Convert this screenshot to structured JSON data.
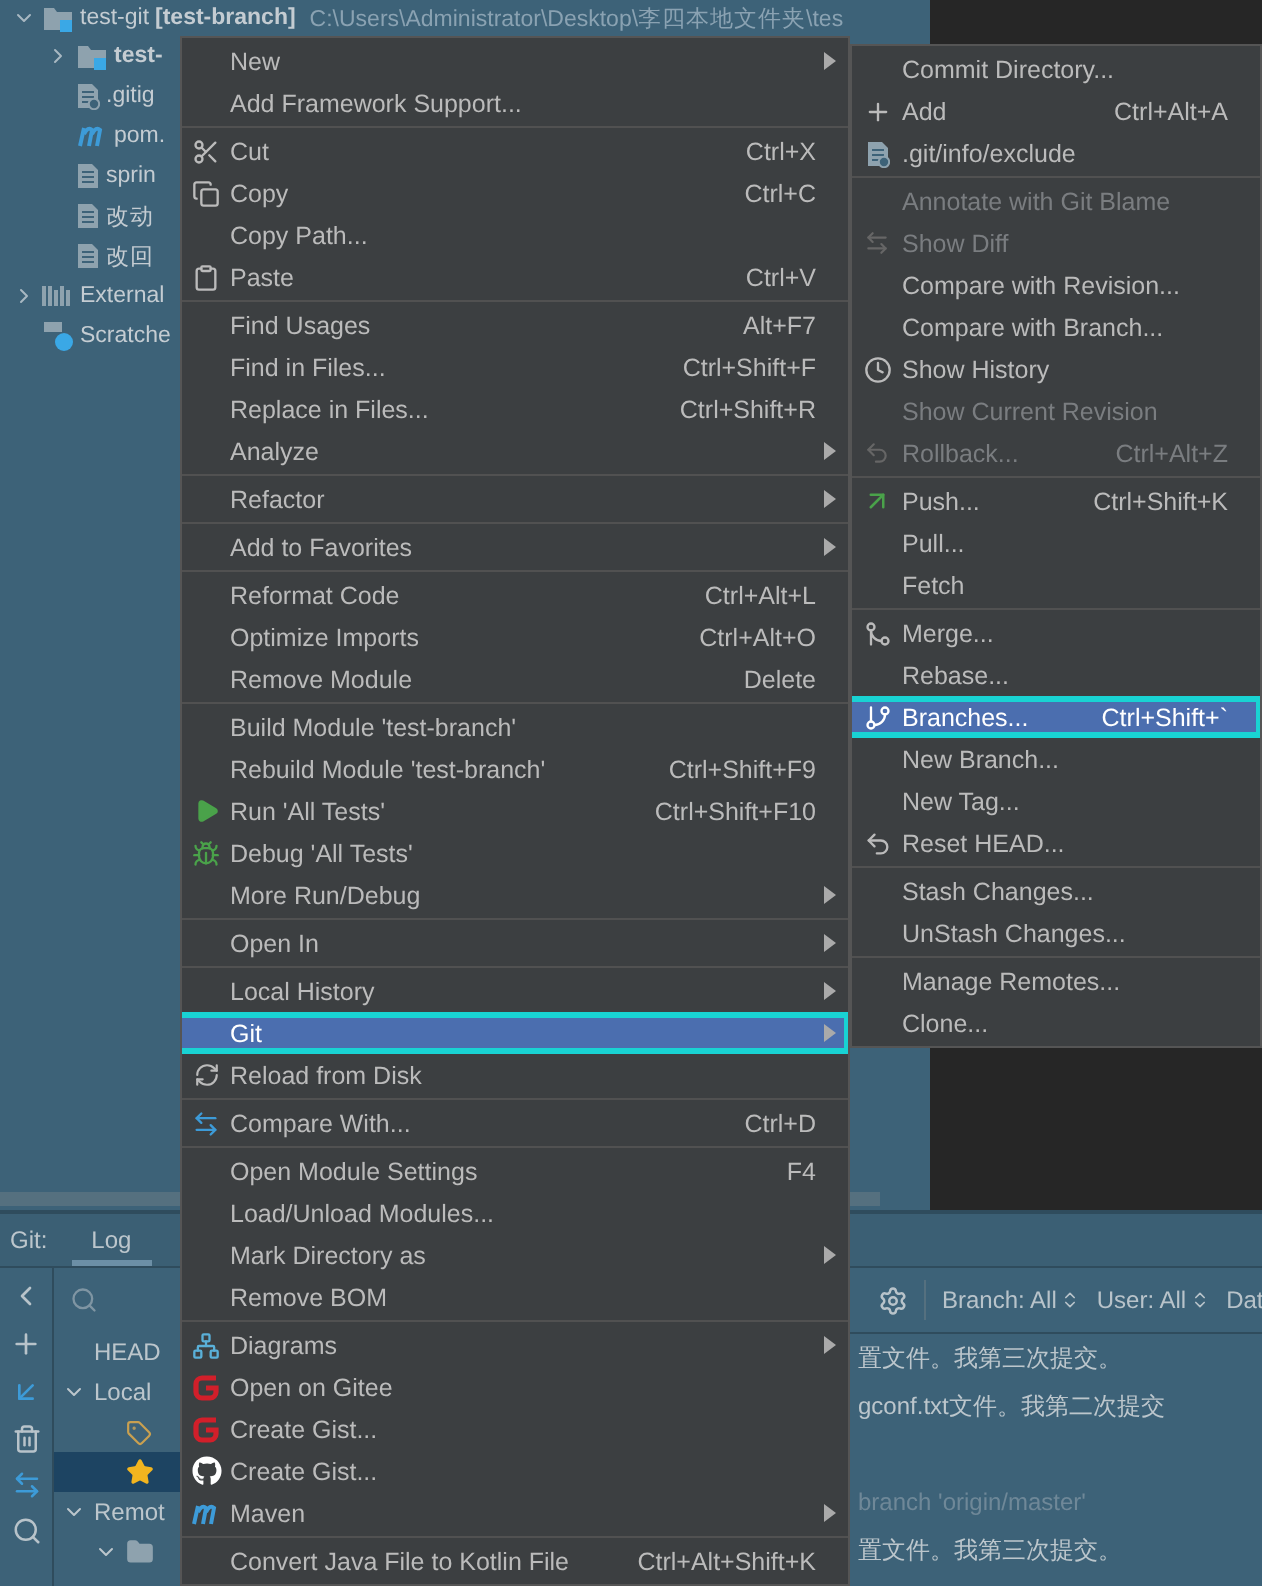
{
  "project_tree": [
    {
      "label": "test-git",
      "kind": "module",
      "expanded": true,
      "branch": "[test-branch]",
      "path": "C:\\Users\\Administrator\\Desktop\\李四本地文件夹\\tes",
      "children": [
        {
          "label": "test-",
          "kind": "module",
          "expanded": false
        },
        {
          "label": ".gitig",
          "kind": "ignored"
        },
        {
          "label": "pom.",
          "kind": "maven"
        },
        {
          "label": "sprin",
          "kind": "file"
        },
        {
          "label": "改动",
          "kind": "file"
        },
        {
          "label": "改回",
          "kind": "file"
        }
      ]
    },
    {
      "label": "External",
      "kind": "library",
      "expanded": false
    },
    {
      "label": "Scratche",
      "kind": "scratch"
    }
  ],
  "context_menu": {
    "groups": [
      {
        "items": [
          {
            "label": "New",
            "submenu": true,
            "selected": false
          },
          {
            "label": "Add Framework Support...",
            "submenu": false,
            "selected": false
          }
        ]
      },
      {
        "items": [
          {
            "label": "Cut",
            "shortcut": "Ctrl+X",
            "submenu": false,
            "selected": false
          },
          {
            "label": "Copy",
            "shortcut": "Ctrl+C",
            "submenu": false,
            "selected": false
          },
          {
            "label": "Copy Path...",
            "submenu": false,
            "selected": false
          },
          {
            "label": "Paste",
            "shortcut": "Ctrl+V",
            "submenu": false,
            "selected": false
          }
        ]
      },
      {
        "items": [
          {
            "label": "Find Usages",
            "shortcut": "Alt+F7",
            "submenu": false,
            "selected": false
          },
          {
            "label": "Find in Files...",
            "shortcut": "Ctrl+Shift+F",
            "submenu": false,
            "selected": false
          },
          {
            "label": "Replace in Files...",
            "shortcut": "Ctrl+Shift+R",
            "submenu": false,
            "selected": false
          },
          {
            "label": "Analyze",
            "submenu": true,
            "selected": false
          }
        ]
      },
      {
        "items": [
          {
            "label": "Refactor",
            "submenu": true,
            "selected": false
          }
        ]
      },
      {
        "items": [
          {
            "label": "Add to Favorites",
            "submenu": true,
            "selected": false
          }
        ]
      },
      {
        "items": [
          {
            "label": "Reformat Code",
            "shortcut": "Ctrl+Alt+L",
            "submenu": false,
            "selected": false
          },
          {
            "label": "Optimize Imports",
            "shortcut": "Ctrl+Alt+O",
            "submenu": false,
            "selected": false
          },
          {
            "label": "Remove Module",
            "shortcut": "Delete",
            "submenu": false,
            "selected": false
          }
        ]
      },
      {
        "items": [
          {
            "label": "Build Module 'test-branch'",
            "submenu": false,
            "selected": false
          },
          {
            "label": "Rebuild Module 'test-branch'",
            "shortcut": "Ctrl+Shift+F9",
            "submenu": false,
            "selected": false
          },
          {
            "label": "Run 'All Tests'",
            "shortcut": "Ctrl+Shift+F10",
            "submenu": false,
            "selected": false
          },
          {
            "label": "Debug 'All Tests'",
            "submenu": false,
            "selected": false
          },
          {
            "label": "More Run/Debug",
            "submenu": true,
            "selected": false
          }
        ]
      },
      {
        "items": [
          {
            "label": "Open In",
            "submenu": true,
            "selected": false
          }
        ]
      },
      {
        "items": [
          {
            "label": "Local History",
            "submenu": true,
            "selected": false
          },
          {
            "label": "Git",
            "submenu": true,
            "selected": true
          },
          {
            "label": "Reload from Disk",
            "submenu": false,
            "selected": false
          }
        ]
      },
      {
        "items": [
          {
            "label": "Compare With...",
            "shortcut": "Ctrl+D",
            "submenu": false,
            "selected": false
          }
        ]
      },
      {
        "items": [
          {
            "label": "Open Module Settings",
            "shortcut": "F4",
            "submenu": false,
            "selected": false
          },
          {
            "label": "Load/Unload Modules...",
            "submenu": false,
            "selected": false
          },
          {
            "label": "Mark Directory as",
            "submenu": true,
            "selected": false
          },
          {
            "label": "Remove BOM",
            "submenu": false,
            "selected": false
          }
        ]
      },
      {
        "items": [
          {
            "label": "Diagrams",
            "submenu": true,
            "selected": false
          },
          {
            "label": "Open on Gitee",
            "submenu": false,
            "selected": false
          },
          {
            "label": "Create Gist...",
            "submenu": false,
            "selected": false
          },
          {
            "label": "Create Gist...",
            "submenu": false,
            "selected": false
          },
          {
            "label": "Maven",
            "submenu": true,
            "selected": false
          }
        ]
      },
      {
        "items": [
          {
            "label": "Convert Java File to Kotlin File",
            "shortcut": "Ctrl+Alt+Shift+K",
            "submenu": false,
            "selected": false
          }
        ]
      }
    ]
  },
  "git_submenu": {
    "groups": [
      {
        "items": [
          {
            "label": "Commit Directory...",
            "disabled": false,
            "selected": false
          },
          {
            "label": "Add",
            "shortcut": "Ctrl+Alt+A",
            "disabled": false,
            "selected": false
          },
          {
            "label": ".git/info/exclude",
            "disabled": false,
            "selected": false
          }
        ]
      },
      {
        "items": [
          {
            "label": "Annotate with Git Blame",
            "disabled": true,
            "selected": false
          },
          {
            "label": "Show Diff",
            "disabled": true,
            "selected": false
          },
          {
            "label": "Compare with Revision...",
            "disabled": false,
            "selected": false
          },
          {
            "label": "Compare with Branch...",
            "disabled": false,
            "selected": false
          },
          {
            "label": "Show History",
            "disabled": false,
            "selected": false
          },
          {
            "label": "Show Current Revision",
            "disabled": true,
            "selected": false
          },
          {
            "label": "Rollback...",
            "shortcut": "Ctrl+Alt+Z",
            "disabled": true,
            "selected": false
          }
        ]
      },
      {
        "items": [
          {
            "label": "Push...",
            "shortcut": "Ctrl+Shift+K",
            "disabled": false,
            "selected": false
          },
          {
            "label": "Pull...",
            "disabled": false,
            "selected": false
          },
          {
            "label": "Fetch",
            "disabled": false,
            "selected": false
          }
        ]
      },
      {
        "items": [
          {
            "label": "Merge...",
            "disabled": false,
            "selected": false
          },
          {
            "label": "Rebase...",
            "disabled": false,
            "selected": false
          },
          {
            "label": "Branches...",
            "shortcut": "Ctrl+Shift+`",
            "disabled": false,
            "selected": true
          },
          {
            "label": "New Branch...",
            "disabled": false,
            "selected": false
          },
          {
            "label": "New Tag...",
            "disabled": false,
            "selected": false
          },
          {
            "label": "Reset HEAD...",
            "disabled": false,
            "selected": false
          }
        ]
      },
      {
        "items": [
          {
            "label": "Stash Changes...",
            "disabled": false,
            "selected": false
          },
          {
            "label": "UnStash Changes...",
            "disabled": false,
            "selected": false
          }
        ]
      },
      {
        "items": [
          {
            "label": "Manage Remotes...",
            "disabled": false,
            "selected": false
          },
          {
            "label": "Clone...",
            "disabled": false,
            "selected": false
          }
        ]
      }
    ]
  },
  "git_panel": {
    "title": "Git:",
    "tabs": [
      {
        "label": "Log",
        "selected": true
      }
    ],
    "branches": [
      {
        "label": "HEAD"
      },
      {
        "label": "Local",
        "expanded": true,
        "children": [
          {
            "kind": "tag",
            "selected": false
          },
          {
            "kind": "star",
            "selected": true
          }
        ]
      },
      {
        "label": "Remot",
        "expanded": true,
        "children": [
          {
            "kind": "folder",
            "expanded": true
          }
        ]
      }
    ],
    "filters": [
      {
        "label": "Branch: All",
        "selector": true
      },
      {
        "label": "User: All",
        "selector": true
      },
      {
        "label": "Dat",
        "selector": false
      }
    ],
    "log": [
      {
        "message": "置文件。我第三次提交。",
        "dimmed": false
      },
      {
        "message": "gconf.txt文件。我第二次提交",
        "dimmed": false
      },
      {
        "message": "branch 'origin/master'",
        "dimmed": true
      },
      {
        "message": "置文件。我第三次提交。",
        "dimmed": false
      }
    ]
  }
}
